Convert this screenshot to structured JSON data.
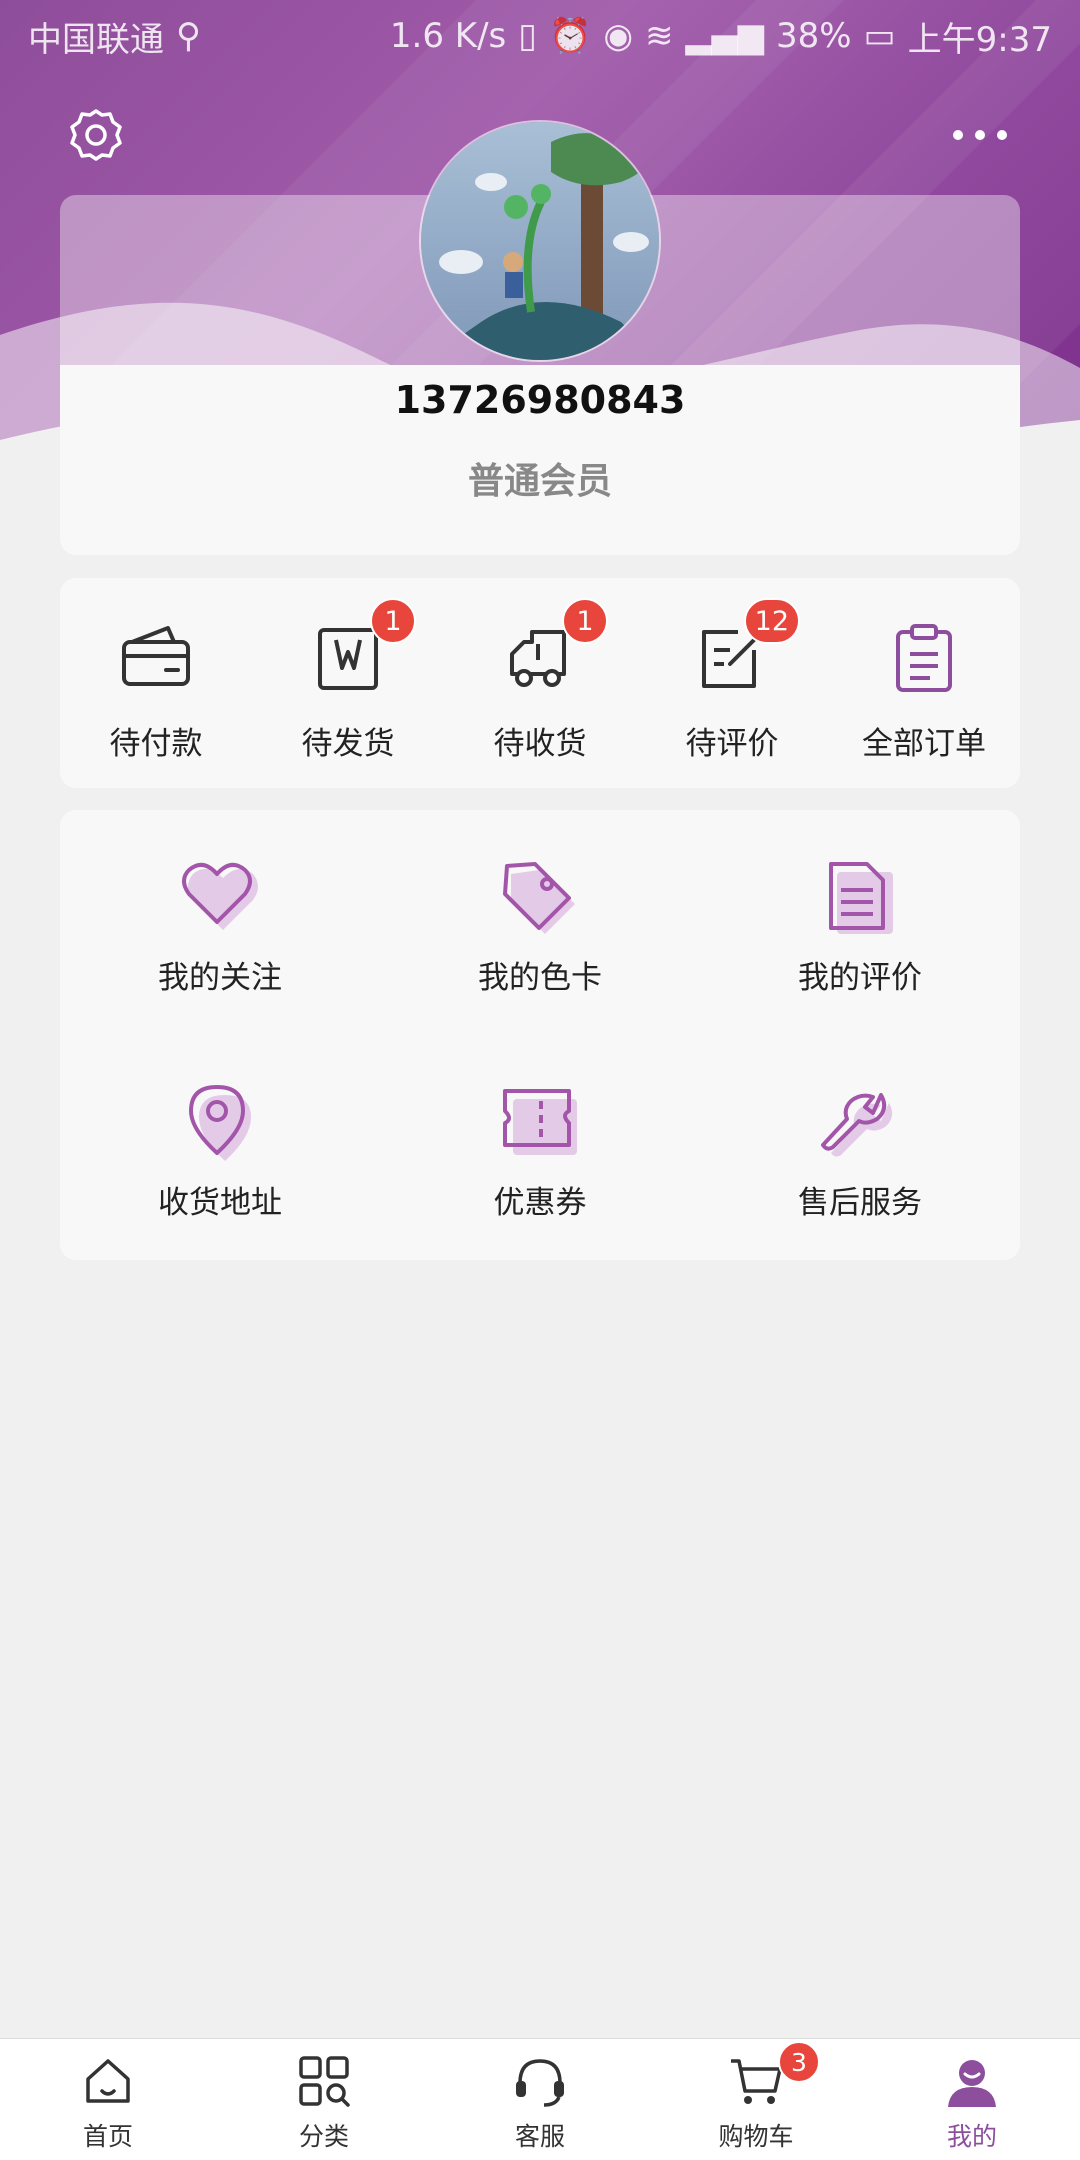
{
  "status_bar": {
    "carrier": "中国联通",
    "speed": "1.6 K/s",
    "battery": "38%",
    "time": "上午9:37"
  },
  "profile": {
    "phone": "13726980843",
    "member_level": "普通会员"
  },
  "orders": [
    {
      "label": "待付款",
      "badge": "",
      "icon": "wallet-icon"
    },
    {
      "label": "待发货",
      "badge": "1",
      "icon": "package-icon"
    },
    {
      "label": "待收货",
      "badge": "1",
      "icon": "truck-icon"
    },
    {
      "label": "待评价",
      "badge": "12",
      "icon": "review-icon"
    },
    {
      "label": "全部订单",
      "badge": "",
      "icon": "clipboard-icon"
    }
  ],
  "services": [
    {
      "label": "我的关注",
      "icon": "heart-icon"
    },
    {
      "label": "我的色卡",
      "icon": "tag-icon"
    },
    {
      "label": "我的评价",
      "icon": "document-icon"
    },
    {
      "label": "收货地址",
      "icon": "location-pin-icon"
    },
    {
      "label": "优惠券",
      "icon": "coupon-icon"
    },
    {
      "label": "售后服务",
      "icon": "wrench-icon"
    }
  ],
  "tabs": [
    {
      "label": "首页",
      "icon": "home-icon",
      "badge": ""
    },
    {
      "label": "分类",
      "icon": "category-icon",
      "badge": ""
    },
    {
      "label": "客服",
      "icon": "headset-icon",
      "badge": ""
    },
    {
      "label": "购物车",
      "icon": "cart-icon",
      "badge": "3"
    },
    {
      "label": "我的",
      "icon": "user-icon",
      "badge": ""
    }
  ],
  "colors": {
    "brand_purple": "#8d4f9d",
    "badge_red": "#e8453c",
    "background": "#f0f0f0"
  }
}
